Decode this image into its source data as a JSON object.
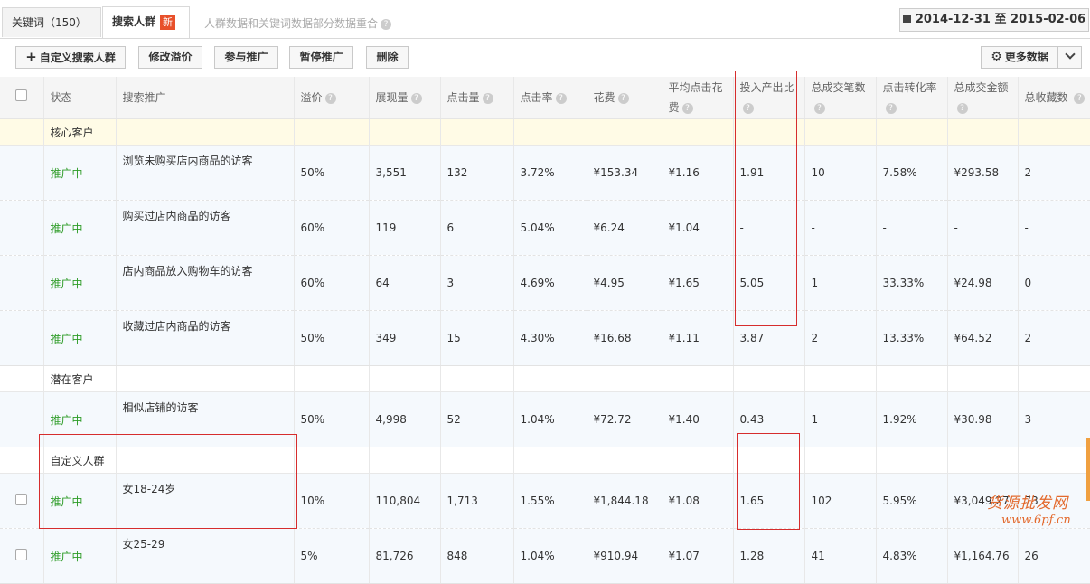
{
  "tabs": [
    {
      "label": "关键词（150）"
    },
    {
      "label": "搜索人群",
      "badge": "新"
    }
  ],
  "tab_note": "人群数据和关键词数据部分数据重合",
  "date_range": "2014-12-31 至 2015-02-06",
  "toolbar": {
    "custom_label": "自定义搜索人群",
    "edit_premium_label": "修改溢价",
    "join_label": "参与推广",
    "pause_label": "暂停推广",
    "delete_label": "删除",
    "more_data_label": "更多数据"
  },
  "table": {
    "headers": [
      "状态",
      "搜索推广",
      "溢价",
      "展现量",
      "点击量",
      "点击率",
      "花费",
      "平均点击花费",
      "投入产出比",
      "总成交笔数",
      "点击转化率",
      "总成交金额",
      "总收藏数"
    ],
    "groups": [
      {
        "name": "核心客户",
        "rows": [
          {
            "status": "推广中",
            "name": "浏览未购买店内商品的访客",
            "premium": "50%",
            "impressions": "3,551",
            "clicks": "132",
            "ctr": "3.72%",
            "cost": "¥153.34",
            "cpc": "¥1.16",
            "roi": "1.91",
            "orders": "10",
            "cvr": "7.58%",
            "gmv": "¥293.58",
            "favs": "2"
          },
          {
            "status": "推广中",
            "name": "购买过店内商品的访客",
            "premium": "60%",
            "impressions": "119",
            "clicks": "6",
            "ctr": "5.04%",
            "cost": "¥6.24",
            "cpc": "¥1.04",
            "roi": "-",
            "orders": "-",
            "cvr": "-",
            "gmv": "-",
            "favs": "-"
          },
          {
            "status": "推广中",
            "name": "店内商品放入购物车的访客",
            "premium": "60%",
            "impressions": "64",
            "clicks": "3",
            "ctr": "4.69%",
            "cost": "¥4.95",
            "cpc": "¥1.65",
            "roi": "5.05",
            "orders": "1",
            "cvr": "33.33%",
            "gmv": "¥24.98",
            "favs": "0"
          },
          {
            "status": "推广中",
            "name": "收藏过店内商品的访客",
            "premium": "50%",
            "impressions": "349",
            "clicks": "15",
            "ctr": "4.30%",
            "cost": "¥16.68",
            "cpc": "¥1.11",
            "roi": "3.87",
            "orders": "2",
            "cvr": "13.33%",
            "gmv": "¥64.52",
            "favs": "2"
          }
        ]
      },
      {
        "name": "潜在客户",
        "rows": [
          {
            "status": "推广中",
            "name": "相似店铺的访客",
            "premium": "50%",
            "impressions": "4,998",
            "clicks": "52",
            "ctr": "1.04%",
            "cost": "¥72.72",
            "cpc": "¥1.40",
            "roi": "0.43",
            "orders": "1",
            "cvr": "1.92%",
            "gmv": "¥30.98",
            "favs": "3"
          }
        ]
      },
      {
        "name": "自定义人群",
        "rows": [
          {
            "status": "推广中",
            "name": "女18-24岁",
            "premium": "10%",
            "impressions": "110,804",
            "clicks": "1,713",
            "ctr": "1.55%",
            "cost": "¥1,844.18",
            "cpc": "¥1.08",
            "roi": "1.65",
            "orders": "102",
            "cvr": "5.95%",
            "gmv": "¥3,049.27",
            "favs": "73"
          },
          {
            "status": "推广中",
            "name": "女25-29",
            "premium": "5%",
            "impressions": "81,726",
            "clicks": "848",
            "ctr": "1.04%",
            "cost": "¥910.94",
            "cpc": "¥1.07",
            "roi": "1.28",
            "orders": "41",
            "cvr": "4.83%",
            "gmv": "¥1,164.76",
            "favs": "26"
          }
        ]
      }
    ]
  },
  "watermark": {
    "line1": "货源批发网",
    "line2": "www.6pf.cn"
  },
  "colors": {
    "status_green": "#2e9c28",
    "highlight_red": "#d62d2d",
    "badge_orange": "#e8502b"
  }
}
